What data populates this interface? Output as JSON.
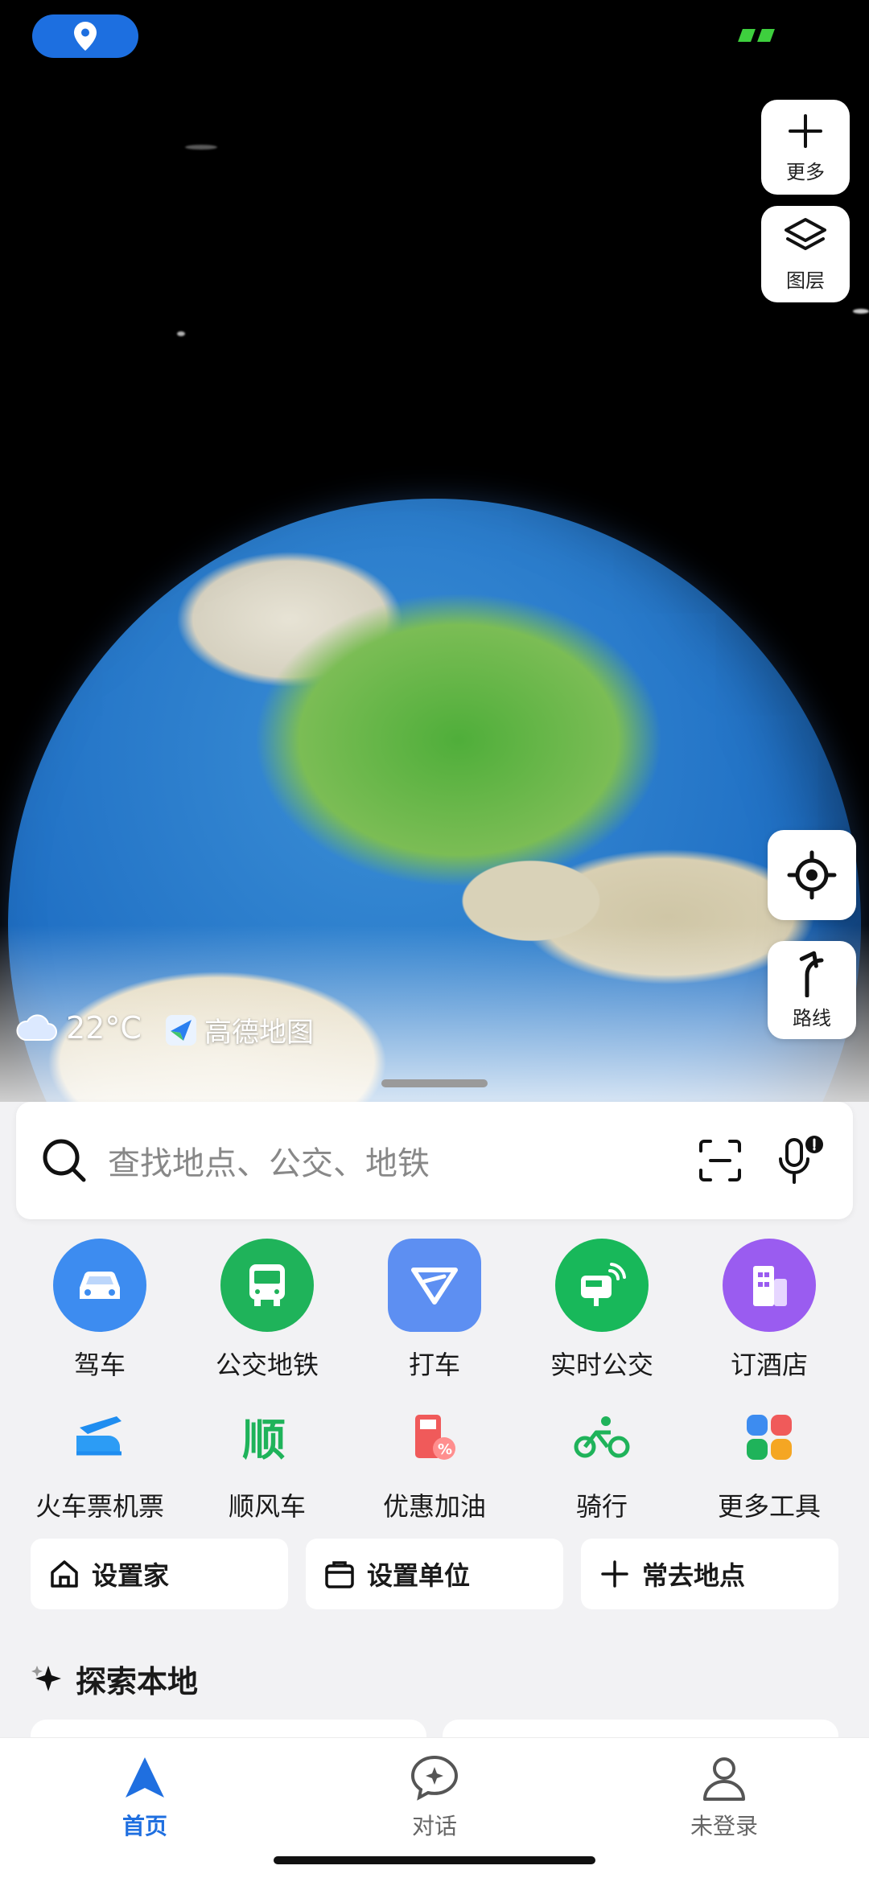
{
  "map": {
    "more_label": "更多",
    "layers_label": "图层",
    "route_label": "路线",
    "temperature": "22°C",
    "brand": "高德地图"
  },
  "search": {
    "placeholder": "查找地点、公交、地铁"
  },
  "tools_row1": [
    {
      "label": "驾车",
      "color": "#3d8cf0",
      "icon": "car-icon"
    },
    {
      "label": "公交地铁",
      "color": "#1fb35a",
      "icon": "bus-icon"
    },
    {
      "label": "打车",
      "color": "#5d8ff2",
      "icon": "taxi-icon"
    },
    {
      "label": "实时公交",
      "color": "#18b85a",
      "icon": "realtime-bus-icon"
    },
    {
      "label": "订酒店",
      "color": "#9a5cf0",
      "icon": "hotel-icon"
    }
  ],
  "tools_row2": [
    {
      "label": "火车票机票",
      "icon": "train-plane-icon"
    },
    {
      "label": "顺风车",
      "icon": "carpool-icon"
    },
    {
      "label": "优惠加油",
      "icon": "fuel-icon"
    },
    {
      "label": "骑行",
      "icon": "bike-icon"
    },
    {
      "label": "更多工具",
      "icon": "more-tools-icon"
    }
  ],
  "quick": {
    "home": "设置家",
    "work": "设置单位",
    "frequent": "常去地点"
  },
  "explore": {
    "title": "探索本地"
  },
  "nav": {
    "home": "首页",
    "chat": "对话",
    "account": "未登录"
  },
  "colors": {
    "accent": "#1f6fe0"
  }
}
